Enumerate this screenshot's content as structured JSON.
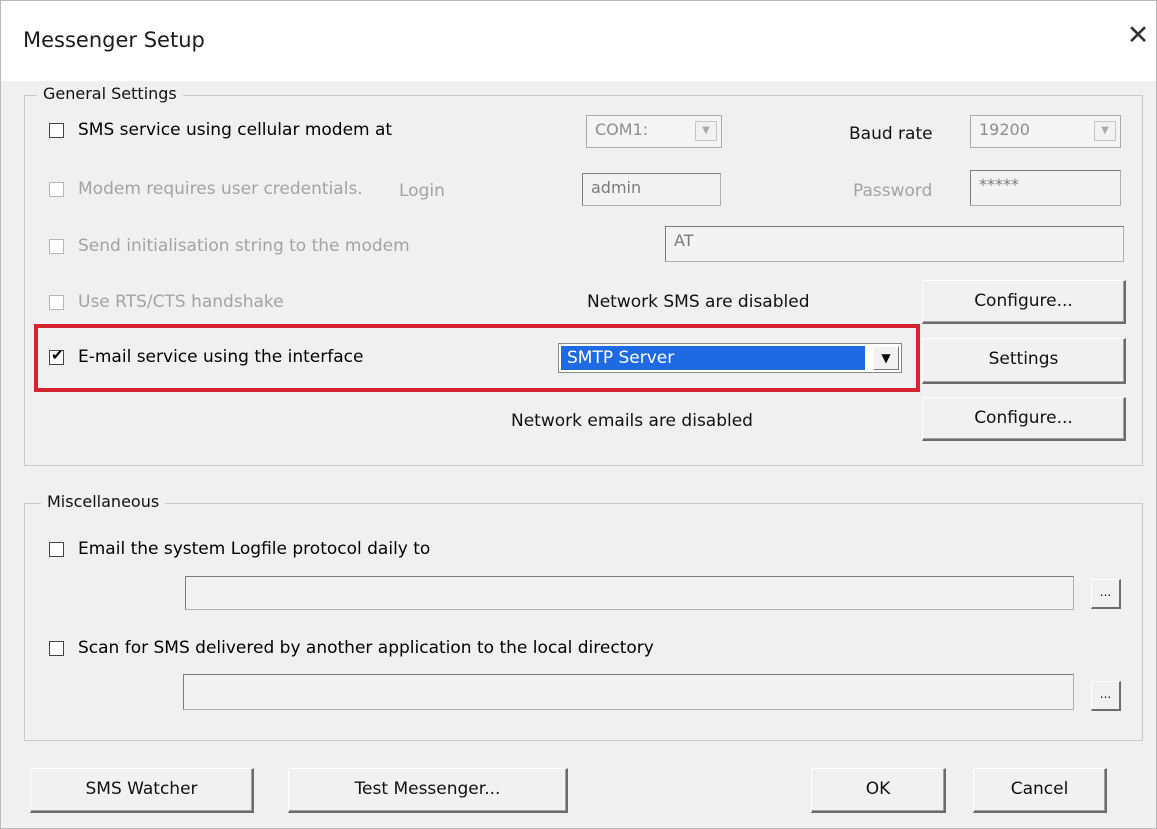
{
  "window": {
    "title": "Messenger Setup",
    "close_glyph": "✕"
  },
  "general": {
    "label": "General Settings",
    "sms": {
      "label": "SMS service using cellular modem at",
      "port": "COM1:",
      "baud_label": "Baud rate",
      "baud": "19200"
    },
    "credentials": {
      "label": "Modem requires user credentials.",
      "login_label": "Login",
      "login": "admin",
      "password_label": "Password",
      "password": "*****"
    },
    "init": {
      "label": "Send initialisation string to the modem",
      "value": "AT"
    },
    "rts": {
      "label": "Use RTS/CTS handshake"
    },
    "network_sms": {
      "status": "Network SMS are disabled",
      "button": "Configure..."
    },
    "email": {
      "label": "E-mail service using the interface",
      "checked_glyph": "✔",
      "interface": "SMTP Server",
      "settings_button": "Settings"
    },
    "network_email": {
      "status": "Network emails are disabled",
      "button": "Configure..."
    }
  },
  "misc": {
    "label": "Miscellaneous",
    "logfile": {
      "label": "Email the system Logfile protocol daily to",
      "browse": "..."
    },
    "scan": {
      "label": "Scan for SMS delivered by another application to the local directory",
      "browse": "..."
    }
  },
  "buttons": {
    "sms_watcher": "SMS Watcher",
    "test": "Test Messenger...",
    "ok": "OK",
    "cancel": "Cancel"
  },
  "colors": {
    "highlight": "#1e6ae3",
    "annotation": "#d6232e"
  }
}
